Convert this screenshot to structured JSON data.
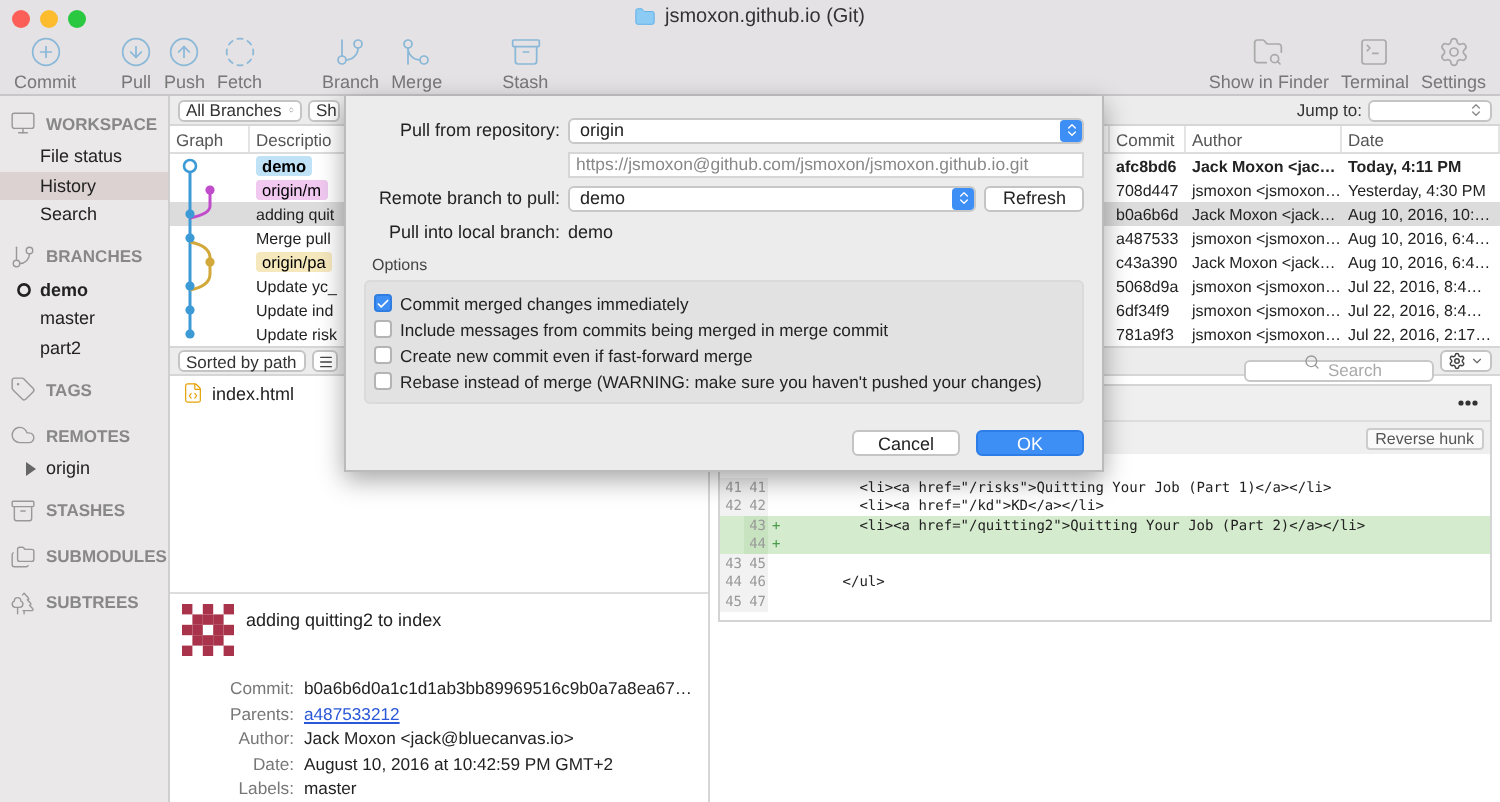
{
  "window": {
    "title": "jsmoxon.github.io (Git)"
  },
  "toolbar": {
    "left": [
      {
        "label": "Commit"
      },
      {
        "label": "Pull"
      },
      {
        "label": "Push"
      },
      {
        "label": "Fetch"
      },
      {
        "label": "Branch"
      },
      {
        "label": "Merge"
      },
      {
        "label": "Stash"
      }
    ],
    "right": [
      {
        "label": "Show in Finder"
      },
      {
        "label": "Terminal"
      },
      {
        "label": "Settings"
      }
    ]
  },
  "sidebar": {
    "sections": [
      {
        "header": "WORKSPACE",
        "items": [
          {
            "label": "File status",
            "selected": false
          },
          {
            "label": "History",
            "selected": true
          },
          {
            "label": "Search",
            "selected": false
          }
        ]
      },
      {
        "header": "BRANCHES",
        "items": [
          {
            "label": "demo",
            "selected": false,
            "current": true
          },
          {
            "label": "master",
            "selected": false,
            "current": false
          },
          {
            "label": "part2",
            "selected": false,
            "current": false
          }
        ]
      },
      {
        "header": "TAGS"
      },
      {
        "header": "REMOTES",
        "items": [
          {
            "label": "origin",
            "selected": false,
            "expanded": false
          }
        ]
      },
      {
        "header": "STASHES"
      },
      {
        "header": "SUBMODULES"
      },
      {
        "header": "SUBTREES"
      }
    ]
  },
  "filter": {
    "branches": "All Branches",
    "show": "Sh",
    "jump_label": "Jump to:"
  },
  "history": {
    "columns": [
      "Graph",
      "Descriptio",
      "Commit",
      "Author",
      "Date"
    ],
    "rows": [
      {
        "tag": {
          "label": "demo",
          "color": "#bfe2f6"
        },
        "commit": "afc8bd6",
        "author": "Jack Moxon <jac…",
        "date": "Today, 4:11 PM",
        "selected": false,
        "head": true
      },
      {
        "tag": {
          "label": "origin/m",
          "color": "#f0c8f0"
        },
        "commit": "708d447",
        "author": "jsmoxon <jsmoxon…",
        "date": "Yesterday, 4:30 PM",
        "selected": false,
        "head": false
      },
      {
        "description": "adding quit",
        "commit": "b0a6b6d",
        "author": "Jack Moxon <jack…",
        "date": "Aug 10, 2016, 10:…",
        "selected": true,
        "head": false
      },
      {
        "description": "Merge pull",
        "commit": "a487533",
        "author": "jsmoxon <jsmoxon…",
        "date": "Aug 10, 2016, 6:4…",
        "selected": false,
        "head": false
      },
      {
        "tag": {
          "label": "origin/pa",
          "color": "#f6e8bd"
        },
        "commit": "c43a390",
        "author": "Jack Moxon <jack…",
        "date": "Aug 10, 2016, 6:4…",
        "selected": false,
        "head": false
      },
      {
        "description": "Update yc_",
        "commit": "5068d9a",
        "author": "jsmoxon <jsmoxon…",
        "date": "Jul 22, 2016, 8:4…",
        "selected": false,
        "head": false
      },
      {
        "description": "Update ind",
        "commit": "6df34f9",
        "author": "jsmoxon <jsmoxon…",
        "date": "Jul 22, 2016, 8:4…",
        "selected": false,
        "head": false
      },
      {
        "description": "Update risk",
        "commit": "781a9f3",
        "author": "jsmoxon <jsmoxon…",
        "date": "Jul 22, 2016, 2:17…",
        "selected": false,
        "head": false
      }
    ]
  },
  "files_bar": {
    "sort": "Sorted by path",
    "search_placeholder": "Search"
  },
  "files": [
    {
      "name": "index.html"
    }
  ],
  "commit_details": {
    "message": "adding quitting2 to index",
    "fields": [
      {
        "label": "Commit:",
        "value": "b0a6b6d0a1c1d1ab3bb89969516c9b0a7a8ea67…",
        "kind": "text"
      },
      {
        "label": "Parents:",
        "value": "a487533212",
        "kind": "link"
      },
      {
        "label": "Author:",
        "value": "Jack Moxon <jack@bluecanvas.io>",
        "kind": "text"
      },
      {
        "label": "Date:",
        "value": "August 10, 2016 at 10:42:59 PM GMT+2",
        "kind": "text"
      },
      {
        "label": "Labels:",
        "value": "master",
        "kind": "text"
      }
    ]
  },
  "diff": {
    "reverse_button": "Reverse hunk",
    "lines": [
      {
        "old": "41",
        "new": "41",
        "code": "        <li><a href=\"/risks\">Quitting Your Job (Part 1)</a></li>",
        "added": false
      },
      {
        "old": "42",
        "new": "42",
        "code": "        <li><a href=\"/kd\">KD</a></li>",
        "added": false
      },
      {
        "new": "43",
        "marker": "+",
        "code": "        <li><a href=\"/quitting2\">Quitting Your Job (Part 2)</a></li>",
        "added": true
      },
      {
        "new": "44",
        "marker": "+",
        "added": true
      },
      {
        "old": "43",
        "new": "45",
        "added": false
      },
      {
        "old": "44",
        "new": "46",
        "code": "      </ul>",
        "added": false
      },
      {
        "old": "45",
        "new": "47",
        "added": false
      }
    ]
  },
  "dialog": {
    "repository_label": "Pull from repository:",
    "repository": "origin",
    "url": "https://jsmoxon@github.com/jsmoxon/jsmoxon.github.io.git",
    "branch_label": "Remote branch to pull:",
    "branch": "demo",
    "refresh": "Refresh",
    "local_label": "Pull into local branch:",
    "local": "demo",
    "options_title": "Options",
    "options": [
      {
        "label": "Commit merged changes immediately",
        "checked": true
      },
      {
        "label": "Include messages from commits being merged in merge commit",
        "checked": false
      },
      {
        "label": "Create new commit even if fast-forward merge",
        "checked": false
      },
      {
        "label": "Rebase instead of merge (WARNING: make sure you haven't pushed your changes)",
        "checked": false
      }
    ],
    "buttons": [
      {
        "label": "Cancel",
        "default": false
      },
      {
        "label": "OK",
        "default": true
      }
    ]
  }
}
